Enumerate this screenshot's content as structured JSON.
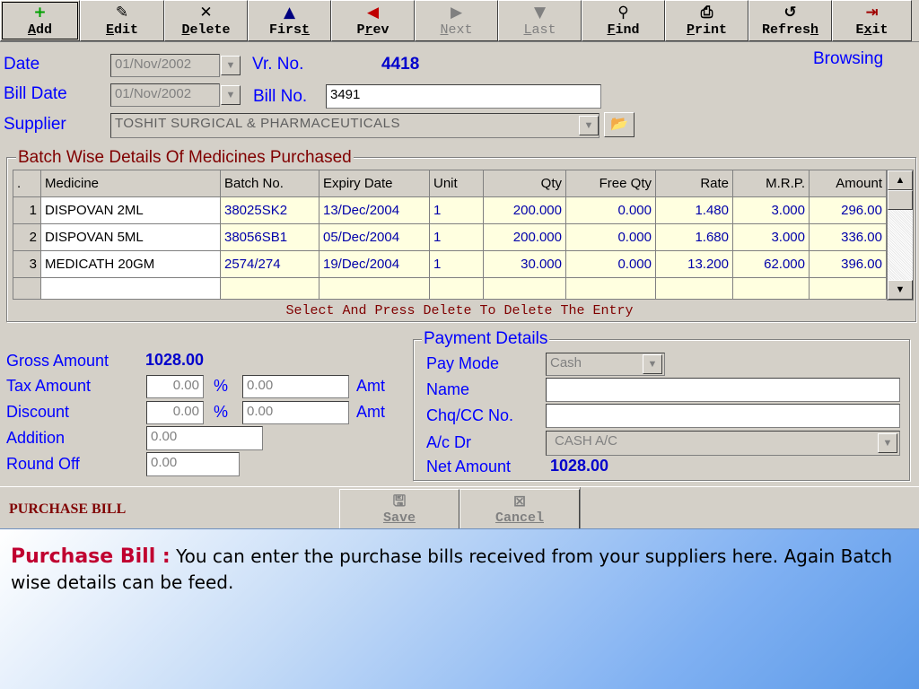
{
  "toolbar": [
    {
      "name": "add",
      "icon": "+",
      "pre": "",
      "u": "A",
      "post": "dd",
      "enabled": true
    },
    {
      "name": "edit",
      "icon": "✎",
      "pre": "",
      "u": "E",
      "post": "dit",
      "enabled": true
    },
    {
      "name": "delete",
      "icon": "✕",
      "pre": "",
      "u": "D",
      "post": "elete",
      "enabled": true
    },
    {
      "name": "first",
      "icon": "▲",
      "pre": "Firs",
      "u": "t",
      "post": "",
      "enabled": true
    },
    {
      "name": "prev",
      "icon": "◀",
      "pre": "P",
      "u": "r",
      "post": "ev",
      "enabled": true
    },
    {
      "name": "next",
      "icon": "▶",
      "pre": "",
      "u": "N",
      "post": "ext",
      "enabled": false
    },
    {
      "name": "last",
      "icon": "▼",
      "pre": "",
      "u": "L",
      "post": "ast",
      "enabled": false
    },
    {
      "name": "find",
      "icon": "⚲",
      "pre": "",
      "u": "F",
      "post": "ind",
      "enabled": true
    },
    {
      "name": "print",
      "icon": "⎙",
      "pre": "",
      "u": "P",
      "post": "rint",
      "enabled": true
    },
    {
      "name": "refresh",
      "icon": "↺",
      "pre": "Refres",
      "u": "h",
      "post": "",
      "enabled": true
    },
    {
      "name": "exit",
      "icon": "⇥",
      "pre": "E",
      "u": "x",
      "post": "it",
      "enabled": true
    }
  ],
  "header": {
    "date_label": "Date",
    "date_value": "01/Nov/2002",
    "vr_label": "Vr. No.",
    "vr_value": "4418",
    "mode": "Browsing",
    "bill_date_label": "Bill Date",
    "bill_date_value": "01/Nov/2002",
    "bill_no_label": "Bill No.",
    "bill_no_value": "3491",
    "supplier_label": "Supplier",
    "supplier_value": "TOSHIT SURGICAL & PHARMACEUTICALS"
  },
  "batch": {
    "title": "Batch Wise Details Of Medicines Purchased",
    "columns": [
      ".",
      "Medicine",
      "Batch No.",
      "Expiry Date",
      "Unit",
      "Qty",
      "Free Qty",
      "Rate",
      "M.R.P.",
      "Amount"
    ],
    "rows": [
      [
        "1",
        "DISPOVAN 2ML",
        "38025SK2",
        "13/Dec/2004",
        "1",
        "200.000",
        "0.000",
        "1.480",
        "3.000",
        "296.00"
      ],
      [
        "2",
        "DISPOVAN 5ML",
        "38056SB1",
        "05/Dec/2004",
        "1",
        "200.000",
        "0.000",
        "1.680",
        "3.000",
        "336.00"
      ],
      [
        "3",
        "MEDICATH 20GM",
        "2574/274",
        "19/Dec/2004",
        "1",
        "30.000",
        "0.000",
        "13.200",
        "62.000",
        "396.00"
      ]
    ],
    "hint": "Select And Press Delete To Delete The Entry"
  },
  "totals": {
    "gross_label": "Gross Amount",
    "gross_value": "1028.00",
    "tax_label": "Tax Amount",
    "tax_pct": "0.00",
    "tax_amt": "0.00",
    "discount_label": "Discount",
    "discount_pct": "0.00",
    "discount_amt": "0.00",
    "addition_label": "Addition",
    "addition_value": "0.00",
    "roundoff_label": "Round Off",
    "roundoff_value": "0.00",
    "pct_symbol": "%",
    "amt_label": "Amt"
  },
  "payment": {
    "title": "Payment Details",
    "paymode_label": "Pay Mode",
    "paymode_value": "Cash",
    "name_label": "Name",
    "name_value": "",
    "chq_label": "Chq/CC No.",
    "chq_value": "",
    "acdr_label": "A/c Dr",
    "acdr_value": "CASH A/C",
    "net_label": "Net Amount",
    "net_value": "1028.00"
  },
  "bottom": {
    "title": "PURCHASE BILL",
    "save_label": "Save",
    "cancel_label": "Cancel"
  },
  "caption": {
    "title": "Purchase Bill :",
    "text": " You can enter the purchase bills received from your suppliers here. Again Batch wise details can be feed."
  }
}
